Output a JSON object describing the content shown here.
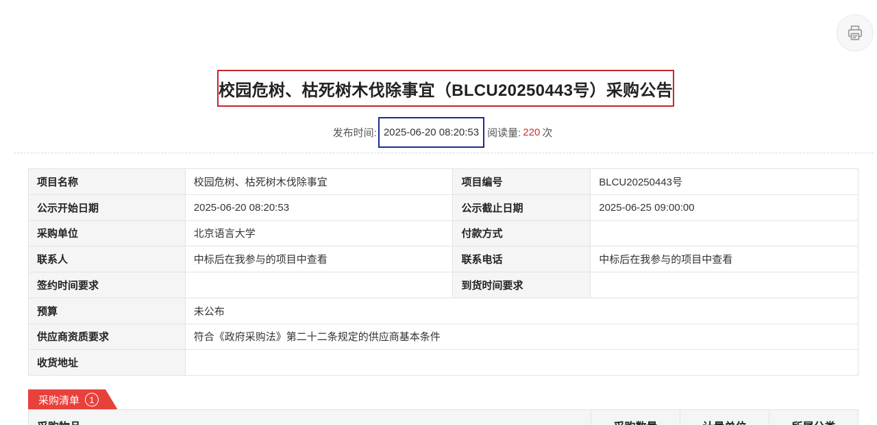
{
  "print_icon": "printer-icon",
  "title": "校园危树、枯死树木伐除事宜（BLCU20250443号）采购公告",
  "meta": {
    "publish_label": "发布时间:",
    "publish_time": "2025-06-20 08:20:53",
    "views_label": "阅读量:",
    "views_count": "220",
    "views_unit": "次"
  },
  "info": {
    "rows": [
      {
        "l1": "项目名称",
        "v1": "校园危树、枯死树木伐除事宜",
        "l2": "项目编号",
        "v2": "BLCU20250443号"
      },
      {
        "l1": "公示开始日期",
        "v1": "2025-06-20 08:20:53",
        "l2": "公示截止日期",
        "v2": "2025-06-25 09:00:00"
      },
      {
        "l1": "采购单位",
        "v1": "北京语言大学",
        "l2": "付款方式",
        "v2": ""
      },
      {
        "l1": "联系人",
        "v1": "中标后在我参与的项目中查看",
        "l2": "联系电话",
        "v2": "中标后在我参与的项目中查看"
      },
      {
        "l1": "签约时间要求",
        "v1": "",
        "l2": "到货时间要求",
        "v2": ""
      }
    ],
    "budget_label": "预算",
    "budget_value": "未公布",
    "qualification_label": "供应商资质要求",
    "qualification_value": "符合《政府采购法》第二十二条规定的供应商基本条件",
    "address_label": "收货地址",
    "address_value": ""
  },
  "tab": {
    "label": "采购清单",
    "count": "1"
  },
  "list_header": [
    "采购物品",
    "采购数量",
    "计量单位",
    "所属分类"
  ],
  "colors": {
    "accent": "#e8413c",
    "title_box": "#c0262d",
    "time_box": "#1a2a8c",
    "views": "#d0322b"
  }
}
